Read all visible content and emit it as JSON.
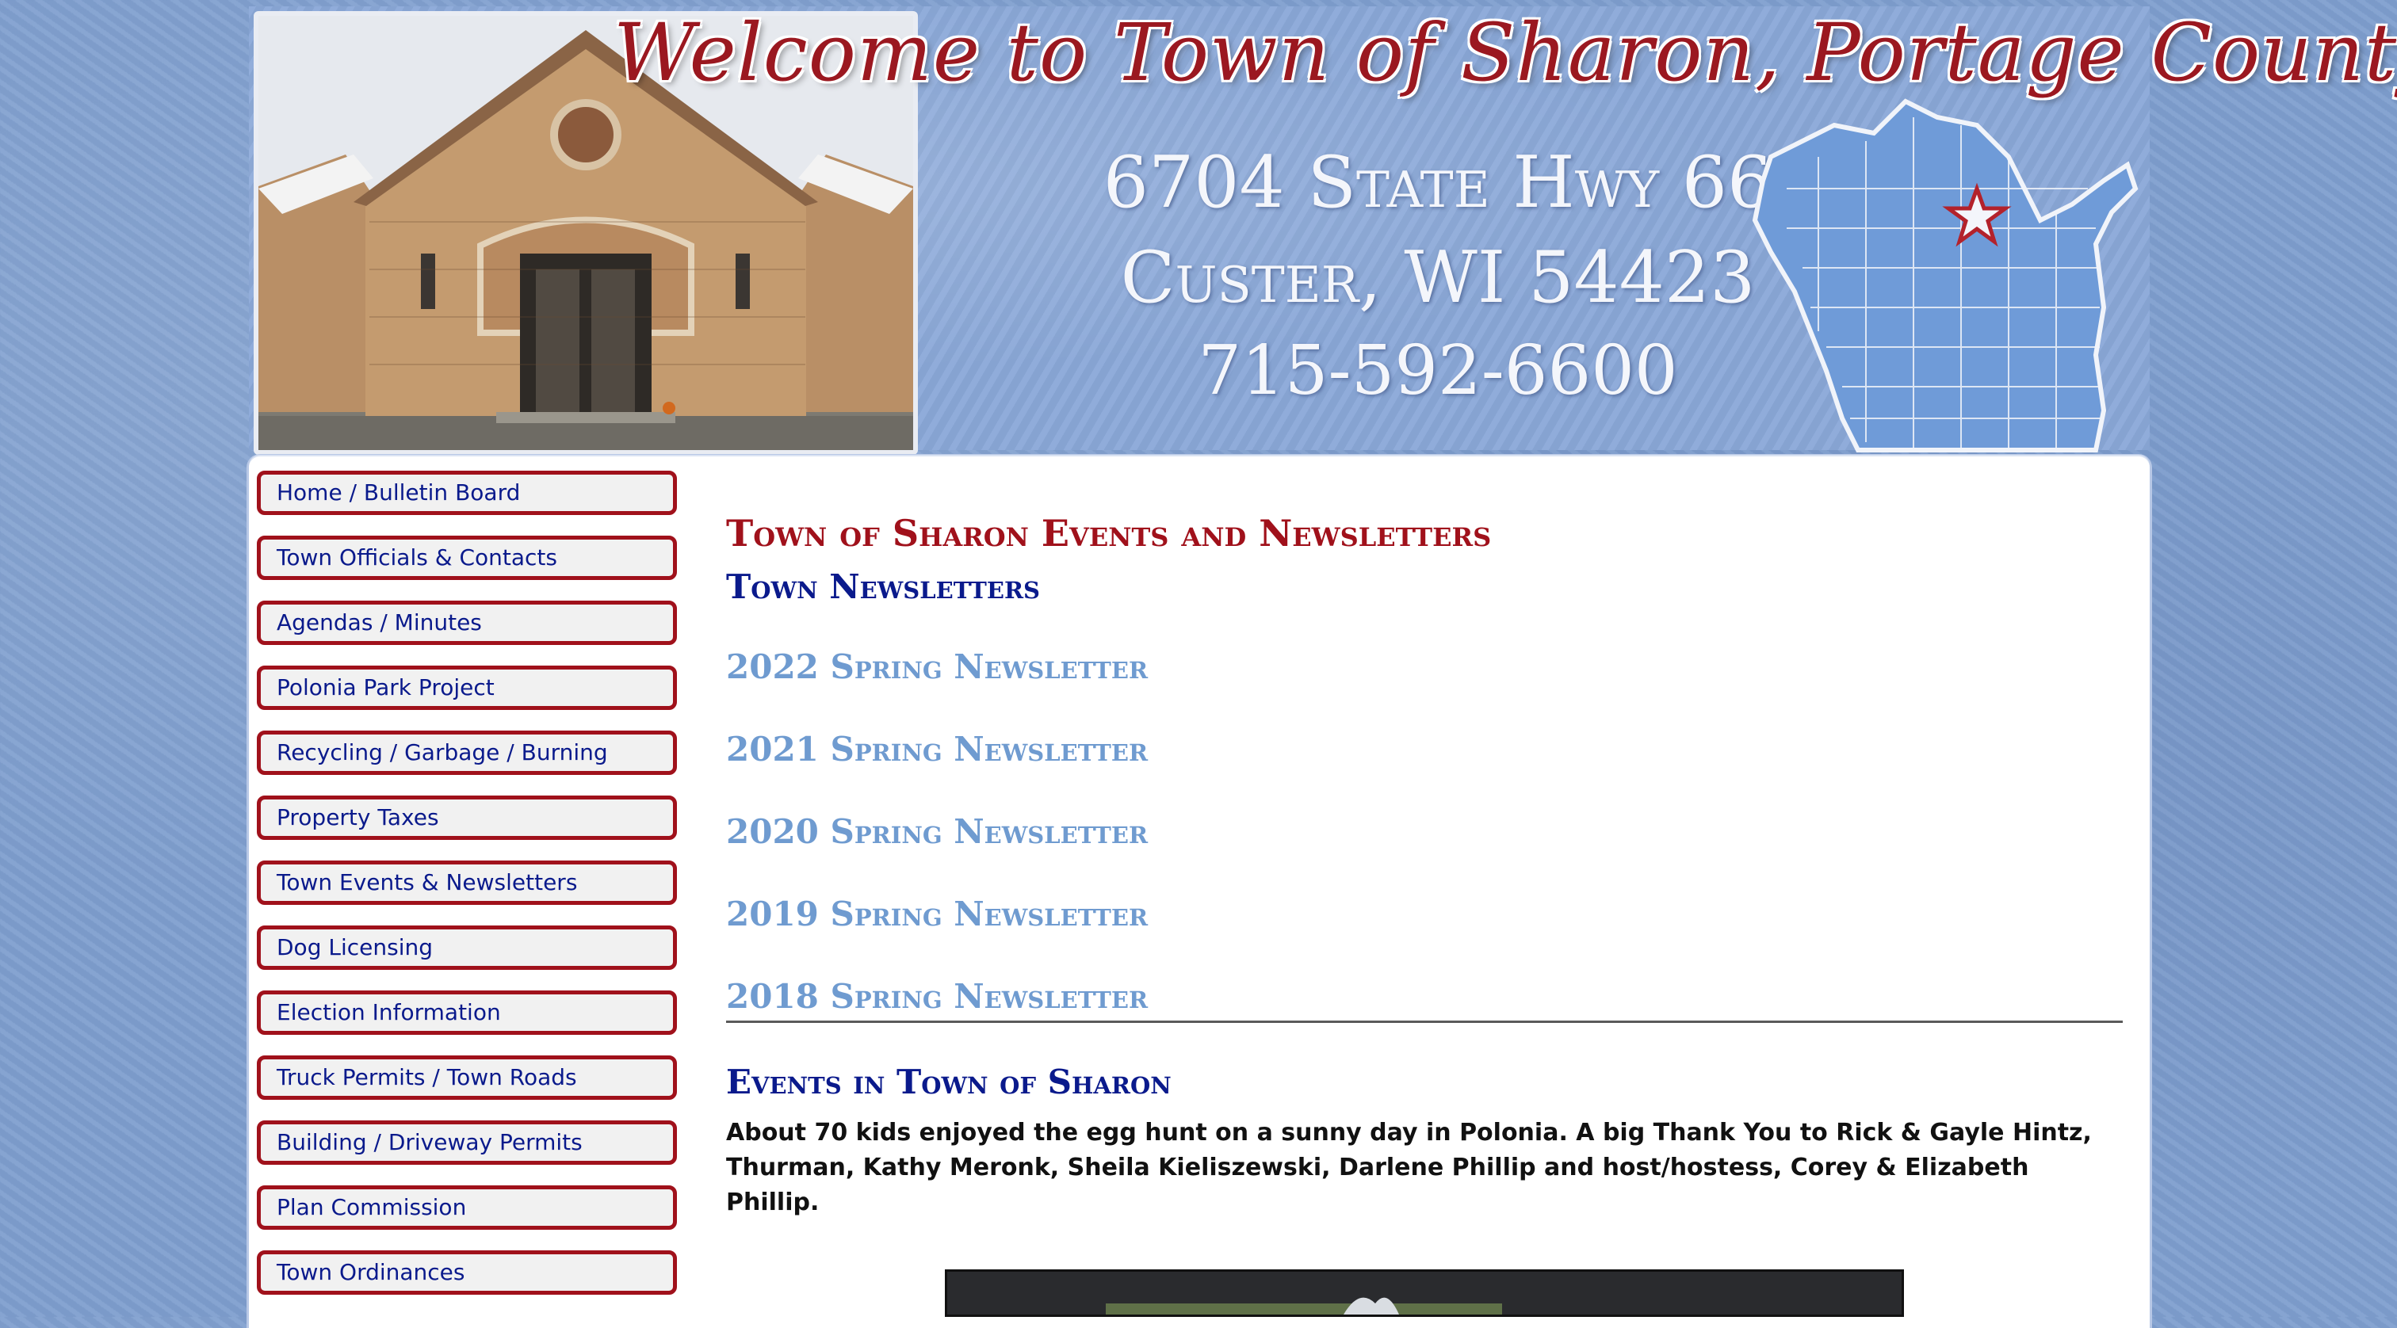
{
  "header": {
    "title": "Welcome to Town of Sharon, Portage County",
    "address_line1": "6704 State Hwy 66",
    "address_line2": "Custer, WI 54423",
    "phone": "715-592-6600",
    "map_icon": "wisconsin-map-icon",
    "star_icon": "location-star-icon",
    "colors": {
      "title": "#9b1820",
      "map": "#6f9bd8",
      "star": "#b3222b"
    }
  },
  "sidebar": {
    "items": [
      {
        "label": "Home / Bulletin Board"
      },
      {
        "label": "Town Officials & Contacts"
      },
      {
        "label": "Agendas / Minutes"
      },
      {
        "label": "Polonia Park Project"
      },
      {
        "label": "Recycling / Garbage / Burning"
      },
      {
        "label": "Property Taxes"
      },
      {
        "label": "Town Events & Newsletters"
      },
      {
        "label": "Dog Licensing"
      },
      {
        "label": "Election Information"
      },
      {
        "label": "Truck Permits / Town Roads"
      },
      {
        "label": "Building / Driveway Permits"
      },
      {
        "label": "Plan Commission"
      },
      {
        "label": "Town Ordinances"
      }
    ]
  },
  "main": {
    "page_title": "Town of Sharon Events and Newsletters",
    "newsletters_heading": "Town Newsletters",
    "newsletters": [
      {
        "label": "2022 Spring Newsletter"
      },
      {
        "label": "2021 Spring Newsletter"
      },
      {
        "label": "2020 Spring Newsletter"
      },
      {
        "label": "2019 Spring Newsletter"
      },
      {
        "label": "2018 Spring Newsletter"
      }
    ],
    "events_heading": "Events in Town of Sharon",
    "event_text": "About 70 kids enjoyed the egg hunt on a sunny day in Polonia. A big Thank You to Rick & Gayle Hintz, Thurman, Kathy Meronk, Sheila Kieliszewski, Darlene Phillip and host/hostess, Corey & Elizabeth Phillip."
  },
  "colors": {
    "nav_border": "#a0111b",
    "nav_text": "#0a1a8c",
    "heading_red": "#a0111b",
    "heading_blue": "#0a1a8c",
    "link_blue": "#6f9bd0"
  }
}
